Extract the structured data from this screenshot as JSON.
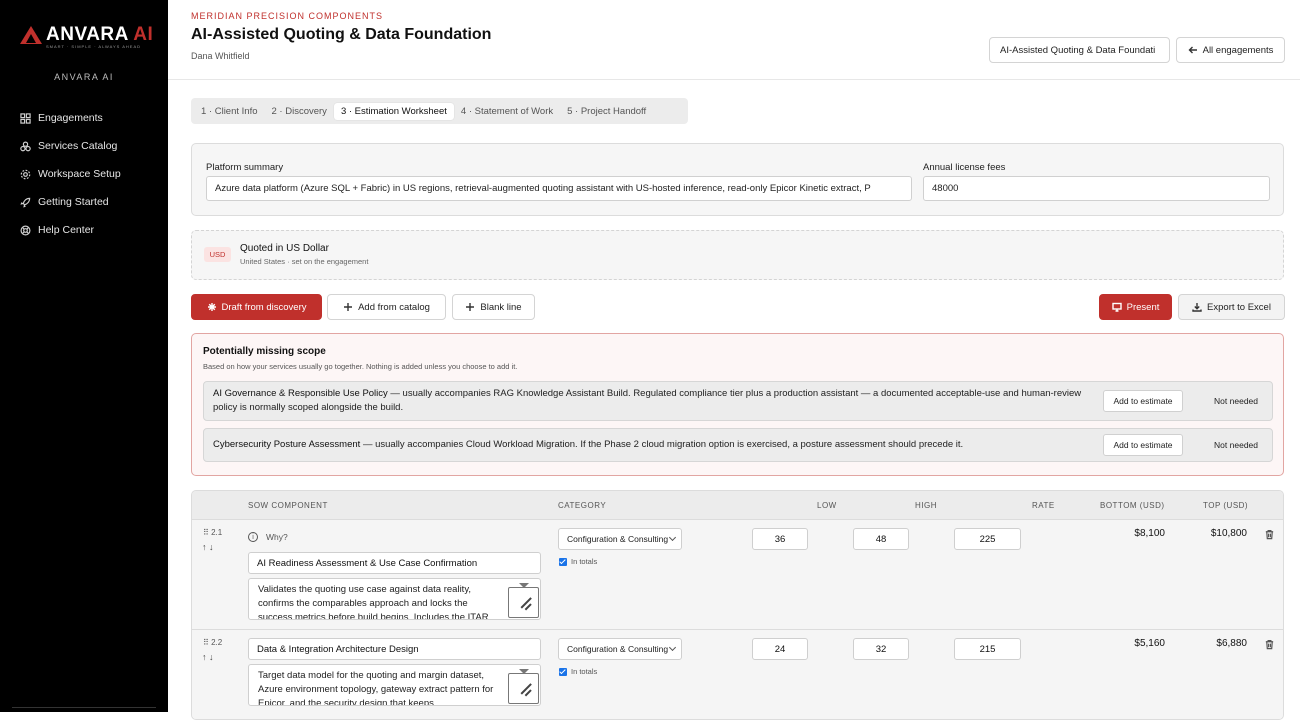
{
  "sidebar": {
    "logo_main": "ANVARA",
    "logo_ai": "AI",
    "logo_tagline": "SMART · SIMPLE · ALWAYS AHEAD",
    "brand_label": "ANVARA AI",
    "items": [
      {
        "label": "Engagements",
        "icon": "grid-icon"
      },
      {
        "label": "Services Catalog",
        "icon": "boxes-icon"
      },
      {
        "label": "Workspace Setup",
        "icon": "gear-icon"
      },
      {
        "label": "Getting Started",
        "icon": "rocket-icon"
      },
      {
        "label": "Help Center",
        "icon": "lifebuoy-icon"
      }
    ]
  },
  "header": {
    "client": "MERIDIAN PRECISION COMPONENTS",
    "title": "AI-Assisted Quoting & Data Foundation",
    "owner": "Dana Whitfield",
    "engagement_button": "AI-Assisted Quoting & Data Foundati",
    "back_button": "All engagements"
  },
  "tabs": [
    {
      "label": "1 · Client Info",
      "active": false
    },
    {
      "label": "2 · Discovery",
      "active": false
    },
    {
      "label": "3 · Estimation Worksheet",
      "active": true
    },
    {
      "label": "4 · Statement of Work",
      "active": false
    },
    {
      "label": "5 · Project Handoff",
      "active": false
    }
  ],
  "platform": {
    "summary_label": "Platform summary",
    "summary_value": "Azure data platform (Azure SQL + Fabric) in US regions, retrieval-augmented quoting assistant with US-hosted inference, read-only Epicor Kinetic extract, P",
    "license_label": "Annual license fees",
    "license_value": "48000"
  },
  "currency": {
    "code": "USD",
    "title": "Quoted in US Dollar",
    "subtitle": "United States · set on the engagement"
  },
  "actions": {
    "draft": "Draft from discovery",
    "add_catalog": "Add from catalog",
    "blank_line": "Blank line",
    "present": "Present",
    "export": "Export to Excel"
  },
  "missing_scope": {
    "title": "Potentially missing scope",
    "subtitle": "Based on how your services usually go together. Nothing is added unless you choose to add it.",
    "add_label": "Add to estimate",
    "dismiss_label": "Not needed",
    "items": [
      {
        "name": "AI Governance & Responsible Use Policy",
        "text": " — usually accompanies RAG Knowledge Assistant Build. Regulated compliance tier plus a production assistant — a documented acceptable-use and human-review policy is normally scoped alongside the build."
      },
      {
        "name": "Cybersecurity Posture Assessment",
        "text": " — usually accompanies Cloud Workload Migration. If the Phase 2 cloud migration option is exercised, a posture assessment should precede it."
      }
    ]
  },
  "table": {
    "headers": {
      "component": "SOW COMPONENT",
      "category": "CATEGORY",
      "low": "LOW",
      "high": "HIGH",
      "rate": "RATE",
      "bottom": "BOTTOM (USD)",
      "top": "TOP (USD)"
    },
    "why_label": "Why?",
    "totals_label": "In totals",
    "rows": [
      {
        "num": "2.1",
        "arrows": "↑ ↓",
        "name": "AI Readiness Assessment & Use Case Confirmation",
        "description": "Validates the quoting use case against data reality, confirms the comparables approach and locks the success metrics before build begins. Includes the ITAR",
        "category": "Configuration & Consulting",
        "low": "36",
        "high": "48",
        "rate": "225",
        "bottom": "$8,100",
        "top": "$10,800"
      },
      {
        "num": "2.2",
        "arrows": "↑ ↓",
        "name": "Data & Integration Architecture Design",
        "description": "Target data model for the quoting and margin dataset, Azure environment topology, gateway extract pattern for Epicor, and the security design that keeps",
        "category": "Configuration & Consulting",
        "low": "24",
        "high": "32",
        "rate": "215",
        "bottom": "$5,160",
        "top": "$6,880"
      }
    ]
  },
  "colors": {
    "accent": "#c0302c",
    "sidebar_bg": "#000000",
    "checkbox": "#1a73e8"
  }
}
